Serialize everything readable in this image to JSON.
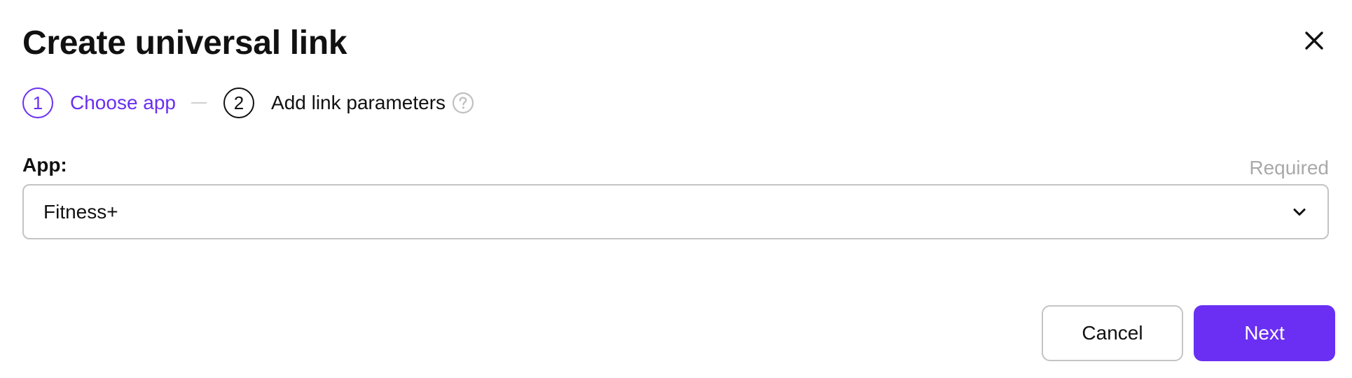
{
  "dialog": {
    "title": "Create universal link",
    "close_icon": "close-icon"
  },
  "stepper": {
    "steps": [
      {
        "number": "1",
        "label": "Choose app",
        "state": "active"
      },
      {
        "number": "2",
        "label": "Add link parameters",
        "state": "upcoming"
      }
    ],
    "help_icon": "question-circle-icon"
  },
  "form": {
    "app_field": {
      "label": "App:",
      "required_text": "Required",
      "selected_value": "Fitness+",
      "dropdown_icon": "chevron-down-icon"
    }
  },
  "actions": {
    "cancel_label": "Cancel",
    "next_label": "Next"
  },
  "colors": {
    "accent": "#6a2ff2",
    "muted_text": "#a9a9a9",
    "border": "#c4c4c4",
    "text": "#111111"
  }
}
